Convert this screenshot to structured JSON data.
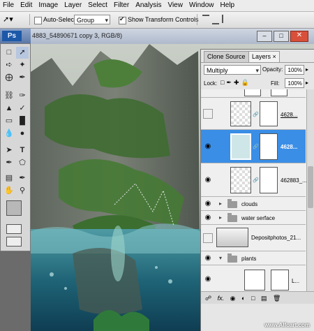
{
  "menu": [
    "File",
    "Edit",
    "Image",
    "Layer",
    "Select",
    "Filter",
    "Analysis",
    "View",
    "Window",
    "Help"
  ],
  "options": {
    "auto_select_label": "Auto-Select:",
    "auto_select_value": "Group",
    "show_transform_label": "Show Transform Controls"
  },
  "document": {
    "title": "4883_54890671 copy 3, RGB/8)"
  },
  "tools": {
    "logo": "Ps"
  },
  "panel": {
    "tabs": [
      "Clone Source",
      "Layers"
    ],
    "blend_mode": "Multiply",
    "opacity_label": "Opacity:",
    "opacity_value": "100%",
    "lock_label": "Lock:",
    "fill_label": "Fill:",
    "fill_value": "100%",
    "layers": [
      {
        "name": "4628...",
        "visible": false
      },
      {
        "name": "4628...",
        "visible": true,
        "selected": true
      },
      {
        "name": "462883_...",
        "visible": true
      },
      {
        "name": "clouds",
        "visible": true,
        "type": "group"
      },
      {
        "name": "water serface",
        "visible": true,
        "type": "group"
      },
      {
        "name": "Depositphotos_21...",
        "visible": false
      },
      {
        "name": "plants",
        "visible": true,
        "type": "group"
      },
      {
        "name": "L...",
        "visible": true
      }
    ]
  },
  "watermark": "www.Alfoart.com",
  "colors": {
    "selection": "#3a8ee6",
    "menubar": "#ececec",
    "panel": "#e6e6e6"
  }
}
